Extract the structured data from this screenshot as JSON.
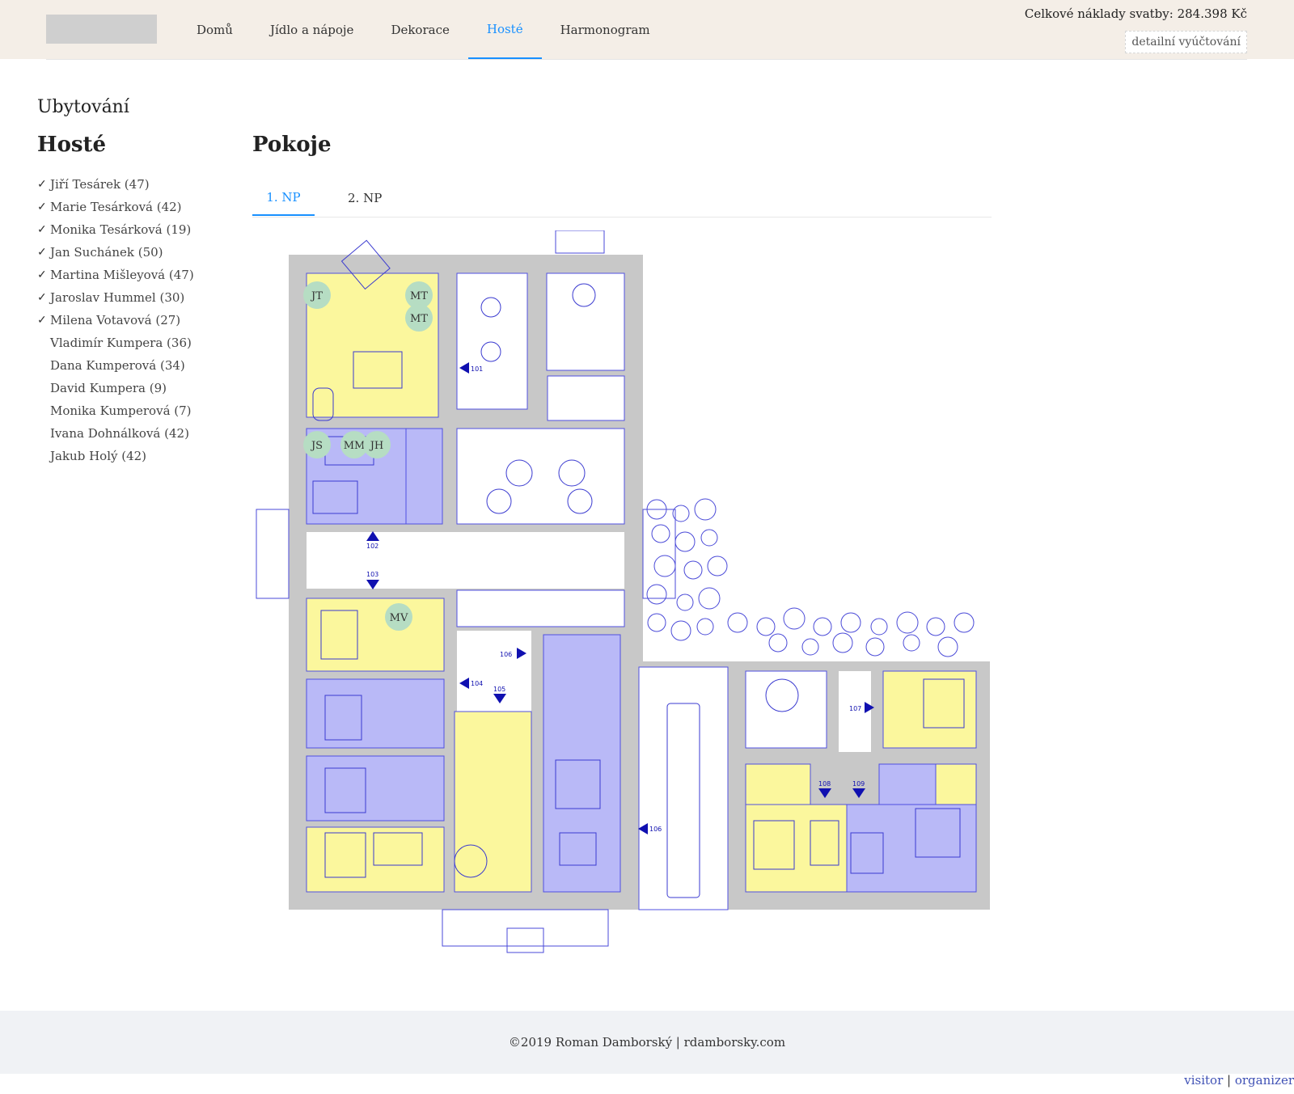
{
  "header": {
    "nav": [
      "Domů",
      "Jídlo a nápoje",
      "Dekorace",
      "Hosté",
      "Harmonogram"
    ],
    "active_nav": "Hosté",
    "total_cost": "Celkové náklady svatby: 284.398 Kč",
    "detail_button": "detailní vyúčtování"
  },
  "sidebar": {
    "subtitle": "Ubytování",
    "title": "Hosté",
    "guests": [
      {
        "name": "Jiří Tesárek (47)",
        "assigned": true
      },
      {
        "name": "Marie Tesárková (42)",
        "assigned": true
      },
      {
        "name": "Monika Tesárková (19)",
        "assigned": true
      },
      {
        "name": "Jan Suchánek (50)",
        "assigned": true
      },
      {
        "name": "Martina Mišleyová (47)",
        "assigned": true
      },
      {
        "name": "Jaroslav Hummel (30)",
        "assigned": true
      },
      {
        "name": "Milena Votavová (27)",
        "assigned": true
      },
      {
        "name": "Vladimír Kumpera (36)",
        "assigned": false
      },
      {
        "name": "Dana Kumperová (34)",
        "assigned": false
      },
      {
        "name": "David Kumpera (9)",
        "assigned": false
      },
      {
        "name": "Monika Kumperová (7)",
        "assigned": false
      },
      {
        "name": "Ivana Dohnálková (42)",
        "assigned": false
      },
      {
        "name": "Jakub Holý (42)",
        "assigned": false
      }
    ]
  },
  "rooms": {
    "title": "Pokoje",
    "tabs": [
      "1. NP",
      "2. NP"
    ],
    "active_tab": "1. NP",
    "room_labels": [
      "101",
      "102",
      "103",
      "104",
      "105",
      "106",
      "107",
      "108",
      "109",
      "106"
    ],
    "guest_markers": [
      "JT",
      "MT",
      "MT",
      "JS",
      "MM",
      "JH",
      "MV"
    ]
  },
  "colors": {
    "accent": "#1890ff",
    "room_yellow": "#fbf79d",
    "room_blue": "#b9b9f7",
    "wall": "#c8c8c8",
    "marker": "#b6ddc3"
  },
  "footer": {
    "copyright": "©2019 Roman Damborský | rdamborsky.com",
    "visitor": "visitor",
    "separator": " | ",
    "organizer": "organizer"
  }
}
